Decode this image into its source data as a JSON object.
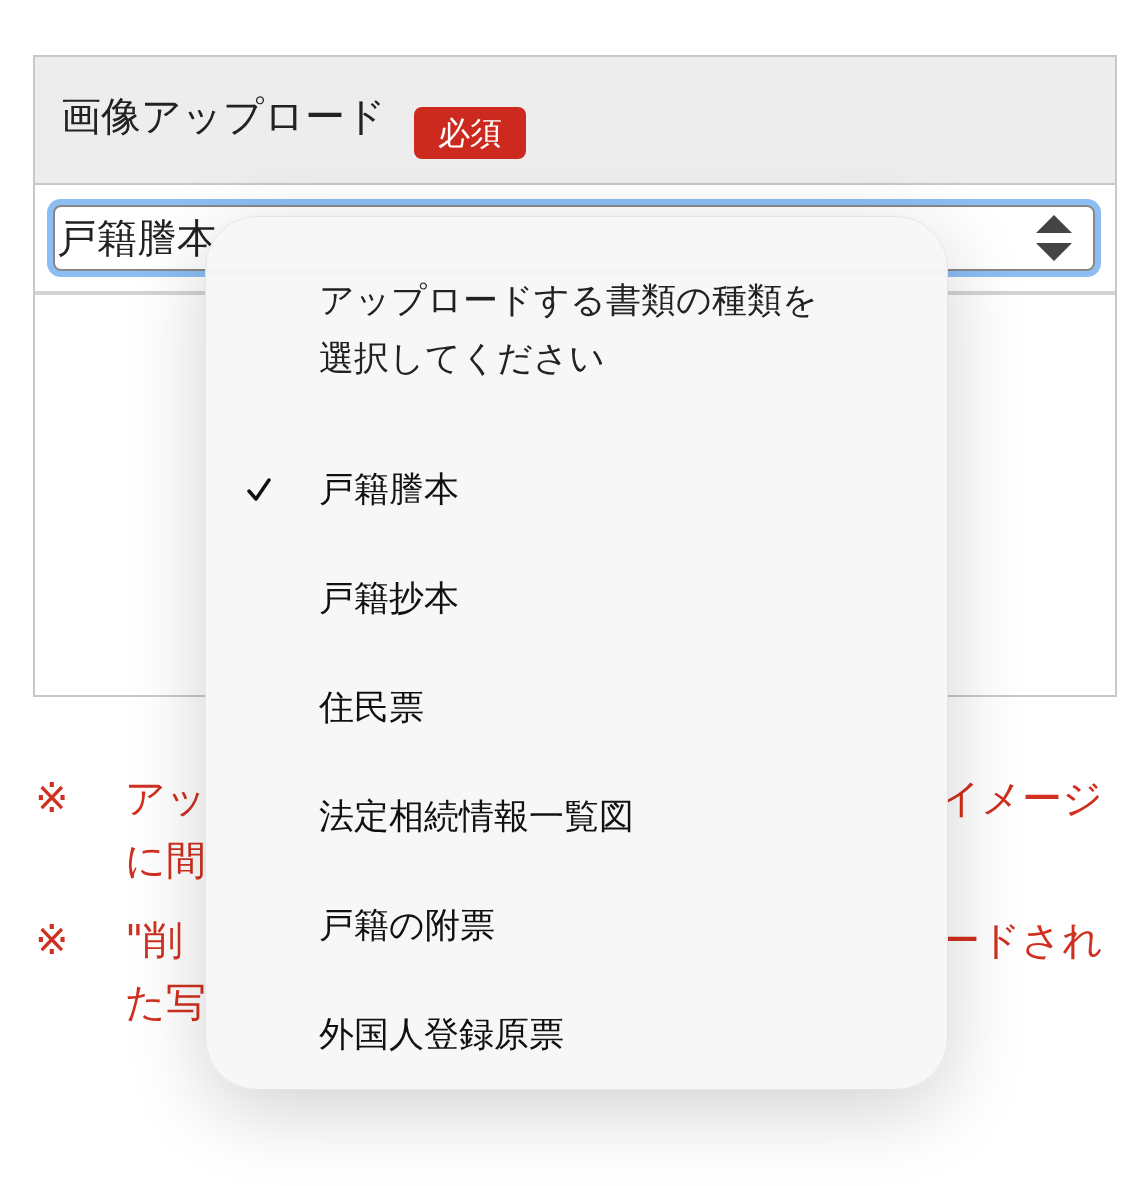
{
  "form": {
    "label": "画像アップロード",
    "badge": "必須",
    "select": {
      "value": "戸籍謄本",
      "focused": true
    }
  },
  "notes": [
    {
      "mark": "※",
      "lines": [
        {
          "start": "アッ",
          "end": "イメージ"
        },
        {
          "start": "に間"
        }
      ]
    },
    {
      "mark": "※",
      "lines": [
        {
          "start": "\"削",
          "end": "ードされ"
        },
        {
          "start": "た写"
        }
      ]
    }
  ],
  "menu": {
    "title": "アップロードする書類の種類を選択してください",
    "items": [
      {
        "label": "戸籍謄本",
        "selected": true
      },
      {
        "label": "戸籍抄本",
        "selected": false
      },
      {
        "label": "住民票",
        "selected": false
      },
      {
        "label": "法定相続情報一覧図",
        "selected": false
      },
      {
        "label": "戸籍の附票",
        "selected": false
      },
      {
        "label": "外国人登録原票",
        "selected": false
      }
    ]
  }
}
